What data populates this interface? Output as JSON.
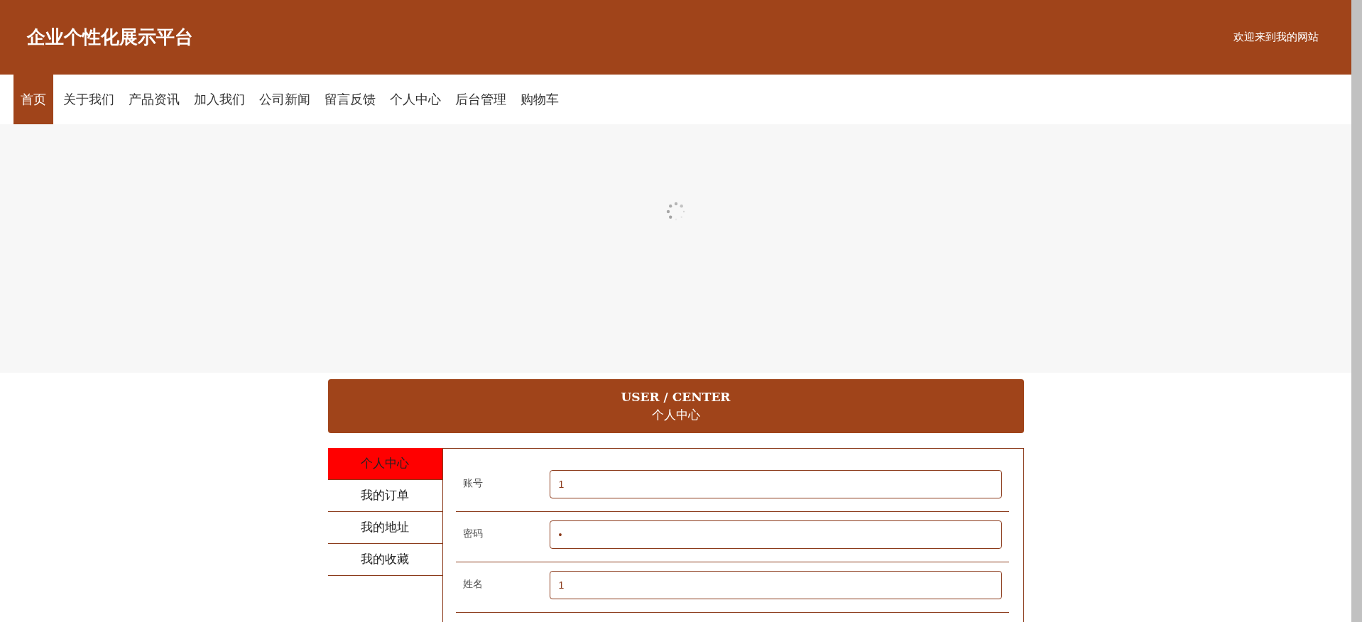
{
  "header": {
    "title": "企业个性化展示平台",
    "welcome": "欢迎来到我的网站"
  },
  "nav": [
    {
      "label": "首页",
      "selected": true
    },
    {
      "label": "关于我们",
      "selected": false
    },
    {
      "label": "产品资讯",
      "selected": false
    },
    {
      "label": "加入我们",
      "selected": false
    },
    {
      "label": "公司新闻",
      "selected": false
    },
    {
      "label": "留言反馈",
      "selected": false
    },
    {
      "label": "个人中心",
      "selected": false
    },
    {
      "label": "后台管理",
      "selected": false
    },
    {
      "label": "购物车",
      "selected": false
    }
  ],
  "section_title": {
    "english": "USER / CENTER",
    "chinese": "个人中心"
  },
  "sidebar": {
    "items": [
      {
        "label": "个人中心",
        "selected": true
      },
      {
        "label": "我的订单",
        "selected": false
      },
      {
        "label": "我的地址",
        "selected": false
      },
      {
        "label": "我的收藏",
        "selected": false
      }
    ]
  },
  "form": {
    "fields": [
      {
        "label": "账号",
        "value": "1"
      },
      {
        "label": "密码",
        "value": "•"
      },
      {
        "label": "姓名",
        "value": "1"
      }
    ]
  }
}
